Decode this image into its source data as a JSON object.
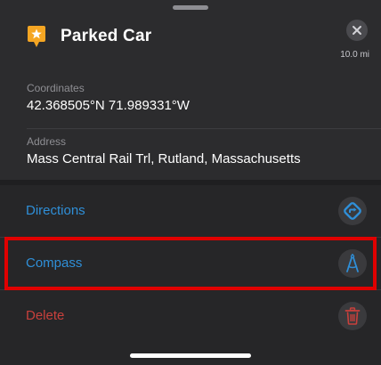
{
  "sheet": {
    "title": "Parked Car",
    "distance": "10.0 mi",
    "pin_icon": "parked-car-pin-icon",
    "close_icon": "close-icon"
  },
  "info": {
    "coordinates_label": "Coordinates",
    "coordinates_value": "42.368505°N  71.989331°W",
    "address_label": "Address",
    "address_value": "Mass Central Rail Trl, Rutland, Massachusetts"
  },
  "actions": [
    {
      "label": "Directions",
      "icon": "directions-icon",
      "color": "#2f8fd8"
    },
    {
      "label": "Compass",
      "icon": "compass-icon",
      "color": "#2f8fd8"
    },
    {
      "label": "Delete",
      "icon": "trash-icon",
      "color": "#c8403c"
    }
  ],
  "colors": {
    "accent": "#2f8fd8",
    "destructive": "#c8403c",
    "pin": "#f5a623",
    "highlight": "#e00000"
  }
}
